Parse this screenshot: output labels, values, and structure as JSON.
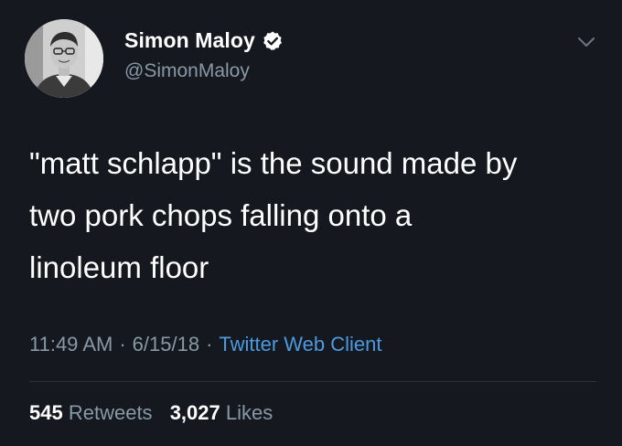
{
  "author": {
    "display_name": "Simon Maloy",
    "handle": "@SimonMaloy",
    "verified": true,
    "avatar_icon": "user-avatar",
    "verified_icon": "verified-badge-icon"
  },
  "tweet": {
    "text": "\"matt schlapp\" is the sound made by\ntwo pork chops falling onto a\nlinoleum floor",
    "time": "11:49 AM",
    "date": "6/15/18",
    "separator": "·",
    "client": "Twitter Web Client"
  },
  "stats": {
    "retweets_count": "545",
    "retweets_label": "Retweets",
    "likes_count": "3,027",
    "likes_label": "Likes"
  },
  "menu_icon": "chevron-down-icon",
  "colors": {
    "background": "#15181f",
    "primary_text": "#ffffff",
    "secondary_text": "#8899a6",
    "link": "#4b9ae0",
    "divider": "#2a323b"
  }
}
